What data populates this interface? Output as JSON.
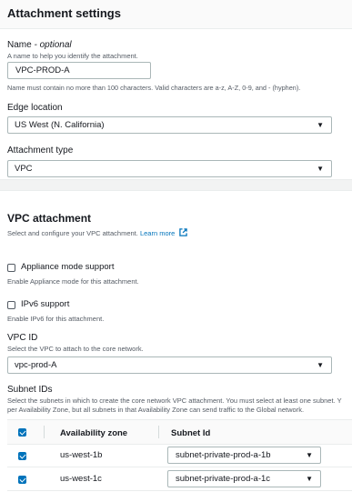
{
  "attachment_settings": {
    "title": "Attachment settings",
    "name_label": "Name",
    "name_optional": "- optional",
    "name_description": "A name to help you identify the attachment.",
    "name_value": "VPC-PROD-A",
    "name_constraint": "Name must contain no more than 100 characters. Valid characters are a-z, A-Z, 0-9, and - (hyphen).",
    "edge_location_label": "Edge location",
    "edge_location_value": "US West (N. California)",
    "attachment_type_label": "Attachment type",
    "attachment_type_value": "VPC"
  },
  "vpc_attachment": {
    "title": "VPC attachment",
    "description": "Select and configure your VPC attachment.",
    "learn_more": "Learn more",
    "appliance_mode_label": "Appliance mode support",
    "appliance_mode_description": "Enable Appliance mode for this attachment.",
    "appliance_mode_checked": false,
    "ipv6_label": "IPv6 support",
    "ipv6_description": "Enable IPv6 for this attachment.",
    "ipv6_checked": false,
    "vpc_id_label": "VPC ID",
    "vpc_id_description": "Select the VPC to attach to the core network.",
    "vpc_id_value": "vpc-prod-A",
    "subnet_ids_label": "Subnet IDs",
    "subnet_ids_description_1": "Select the subnets in which to create the core network VPC attachment. You must select at least one subnet. Y",
    "subnet_ids_description_2": "per Availability Zone, but all subnets in that Availability Zone can send traffic to the Global network."
  },
  "subnet_table": {
    "columns": [
      "Availability zone",
      "Subnet Id"
    ],
    "rows": [
      {
        "zone": "us-west-1b",
        "subnet": "subnet-private-prod-a-1b",
        "checked": true
      },
      {
        "zone": "us-west-1c",
        "subnet": "subnet-private-prod-a-1c",
        "checked": true
      }
    ]
  },
  "colors": {
    "link": "#0073bb",
    "checkbox_checked": "#0073bb"
  }
}
